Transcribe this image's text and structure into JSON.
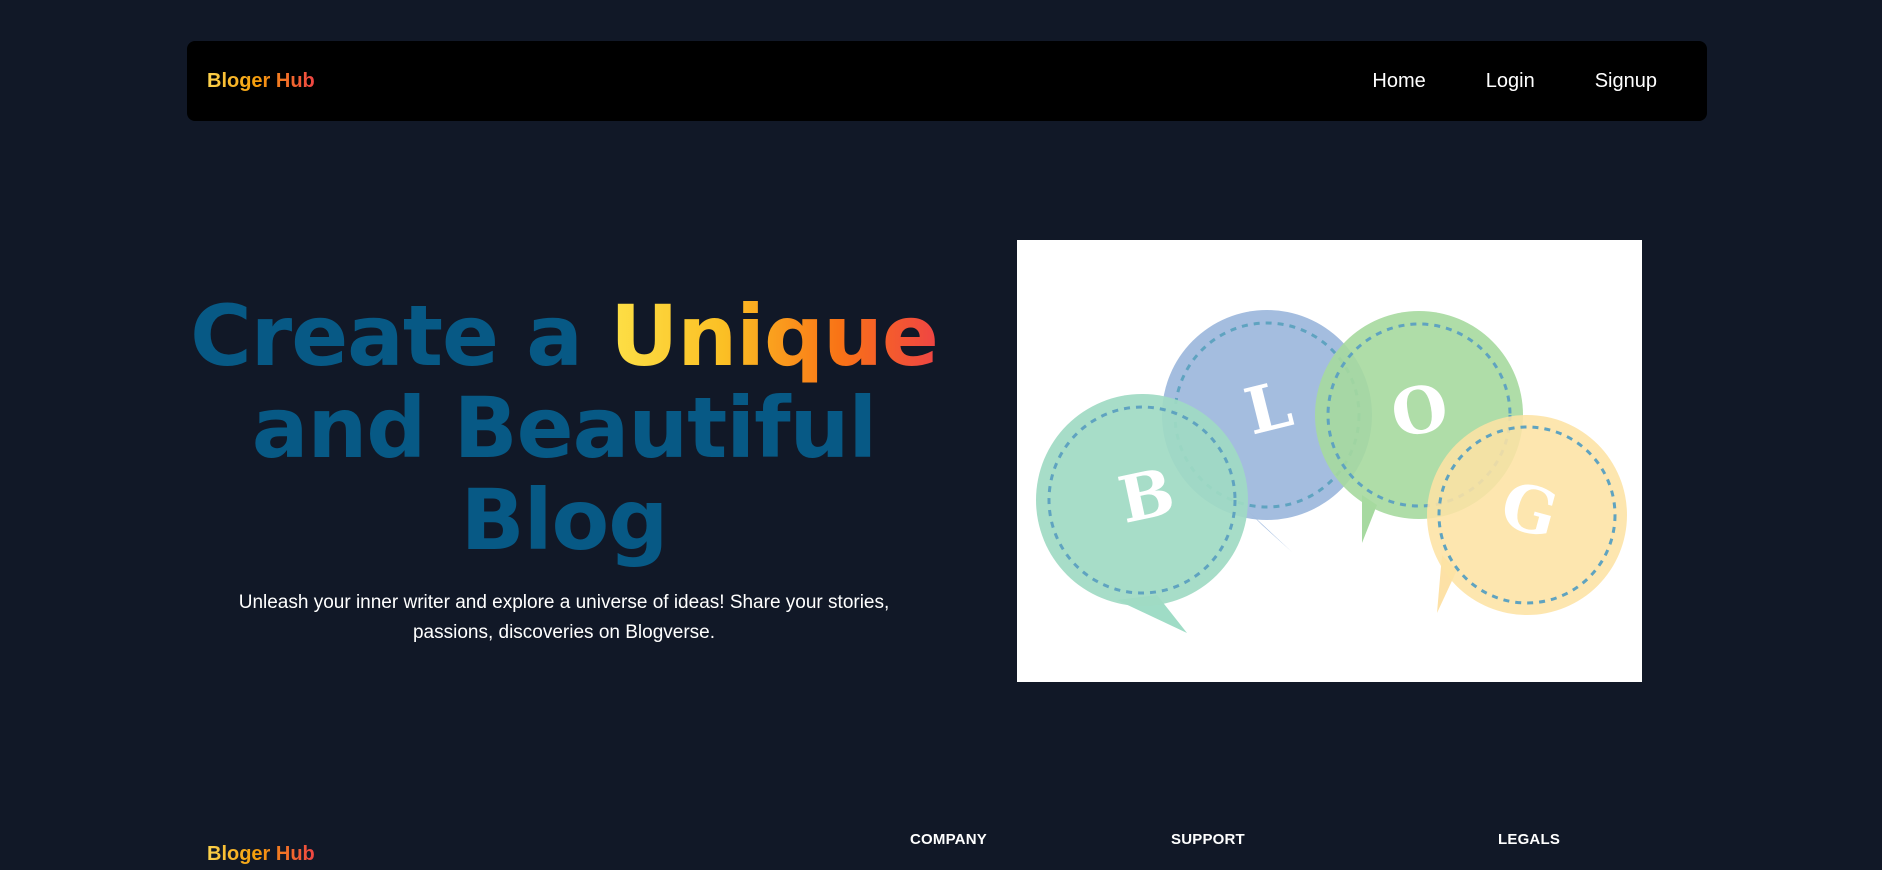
{
  "navbar": {
    "brand": "Bloger Hub",
    "links": [
      {
        "label": "Home"
      },
      {
        "label": "Login"
      },
      {
        "label": "Signup"
      }
    ]
  },
  "hero": {
    "title_part1": "Create a ",
    "title_accent": "Unique",
    "title_part2": "and Beautiful",
    "title_part3": "Blog",
    "subtitle": "Unleash your inner writer and explore a universe of ideas! Share your stories, passions, discoveries on Blogverse.",
    "image": {
      "letters": [
        "B",
        "L",
        "O",
        "G"
      ]
    }
  },
  "footer": {
    "brand": "Bloger Hub",
    "columns": [
      {
        "heading": "COMPANY"
      },
      {
        "heading": "SUPPORT"
      },
      {
        "heading": "LEGALS"
      }
    ]
  },
  "colors": {
    "background": "#111827",
    "navbar": "#000000",
    "title_blue": "#075985",
    "accent_start": "#fde047",
    "accent_end": "#ef4444"
  }
}
